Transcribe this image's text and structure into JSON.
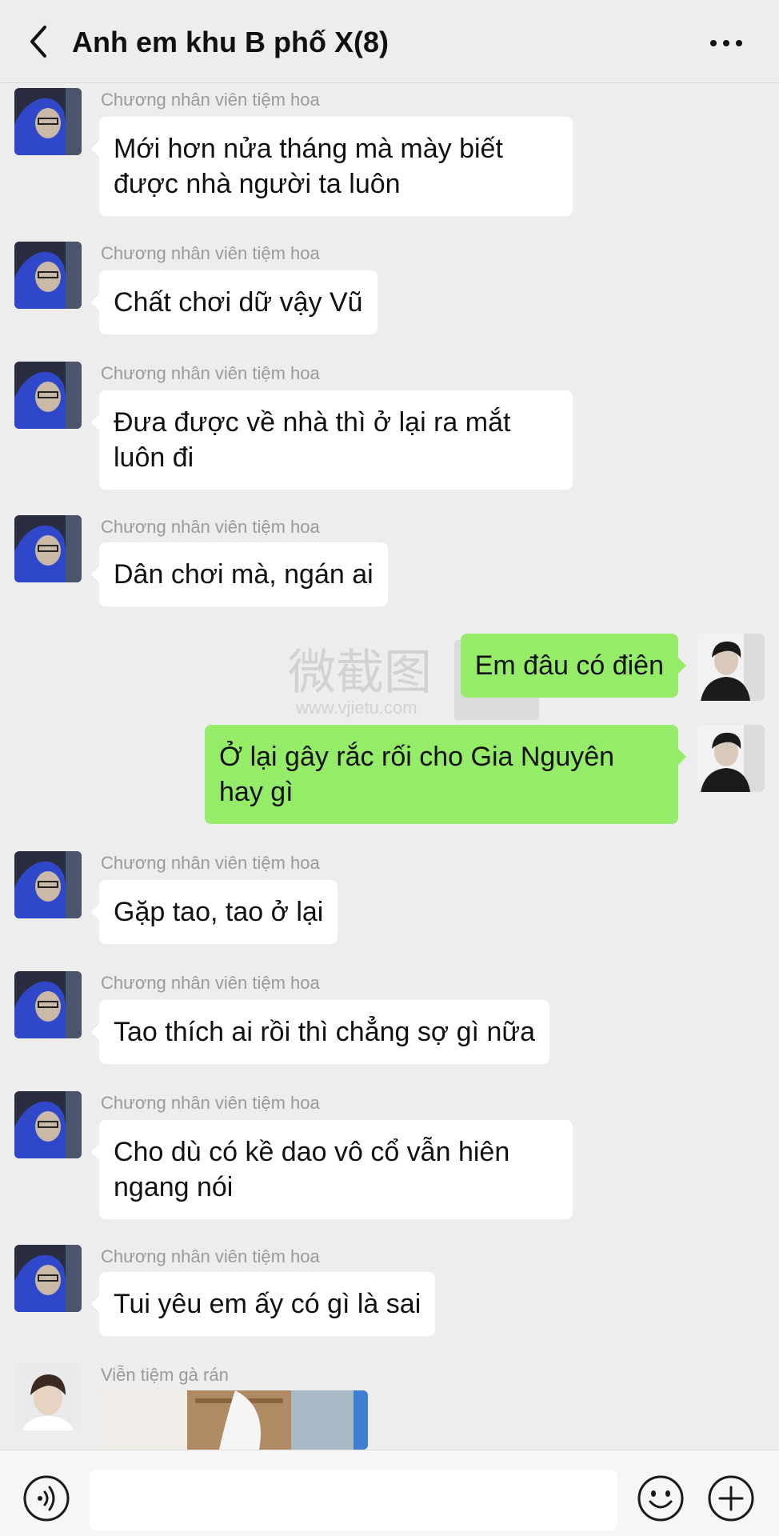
{
  "header": {
    "title": "Anh em khu B phố X(8)",
    "back_icon": "chevron-left-icon",
    "more_icon": "more-dots-icon"
  },
  "messages": [
    {
      "direction": "in",
      "sender": "Chương nhân viên tiệm hoa",
      "text": "Mới hơn nửa tháng mà mày biết được nhà người ta luôn"
    },
    {
      "direction": "in",
      "sender": "Chương nhân viên tiệm hoa",
      "text": "Chất chơi dữ vậy Vũ"
    },
    {
      "direction": "in",
      "sender": "Chương nhân viên tiệm hoa",
      "text": "Đưa được về nhà thì ở lại ra mắt luôn đi"
    },
    {
      "direction": "in",
      "sender": "Chương nhân viên tiệm hoa",
      "text": "Dân chơi mà, ngán ai"
    },
    {
      "direction": "out",
      "text": "Em đâu có điên"
    },
    {
      "direction": "out",
      "text": "Ở lại gây rắc rối cho Gia Nguyên hay gì"
    },
    {
      "direction": "in",
      "sender": "Chương nhân viên tiệm hoa",
      "text": "Gặp tao, tao ở lại"
    },
    {
      "direction": "in",
      "sender": "Chương nhân viên tiệm hoa",
      "text": "Tao thích ai rồi thì chẳng sợ gì nữa"
    },
    {
      "direction": "in",
      "sender": "Chương nhân viên tiệm hoa",
      "text": "Cho dù có kề dao vô cổ vẫn hiên ngang nói"
    },
    {
      "direction": "in",
      "sender": "Chương nhân viên tiệm hoa",
      "text": "Tui yêu em ấy có gì là sai"
    },
    {
      "direction": "in",
      "sender": "Viễn tiệm gà rán",
      "text": ""
    }
  ],
  "watermark": {
    "chinese": "微截图",
    "url": "www.vjietu.com"
  },
  "input_bar": {
    "voice_icon": "voice-icon",
    "emoji_icon": "emoji-icon",
    "plus_icon": "plus-icon",
    "placeholder": ""
  },
  "colors": {
    "background": "#ededed",
    "incoming_bubble": "#ffffff",
    "outgoing_bubble": "#95ec69",
    "sender_name": "#9a9a9a"
  }
}
